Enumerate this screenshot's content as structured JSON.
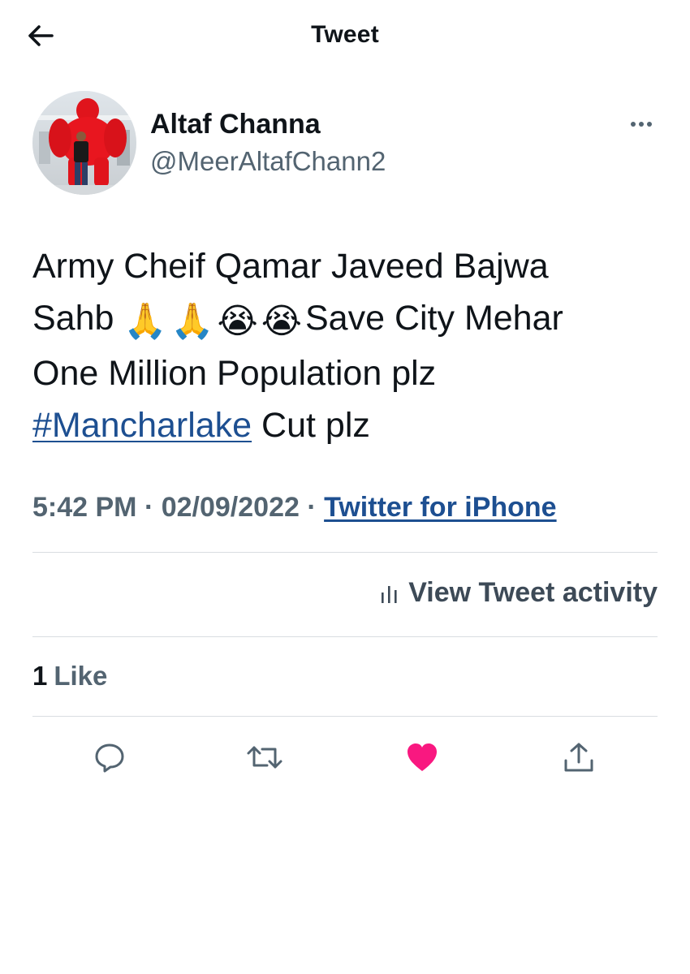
{
  "header": {
    "title": "Tweet",
    "back_icon": "arrow-left-icon"
  },
  "author": {
    "display_name": "Altaf Channa",
    "handle": "@MeerAltafChann2",
    "more_icon": "more-horizontal-icon"
  },
  "tweet": {
    "line1": "Army Cheif  Qamar Javeed Bajwa",
    "line2_prefix": "Sahb",
    "line2_emojis": [
      "🙏",
      "🙏",
      "😭",
      "😭"
    ],
    "line2_suffix": "Save City Mehar",
    "line3": "One Million Population plz",
    "hashtag": "#Mancharlake",
    "line4_suffix": " Cut plz"
  },
  "meta": {
    "time": "5:42 PM",
    "separator": " · ",
    "date": "02/09/2022",
    "source": "Twitter for iPhone"
  },
  "activity": {
    "label": "View Tweet activity",
    "icon": "analytics-bars-icon"
  },
  "likes": {
    "count": "1",
    "label": "Like"
  },
  "actions": {
    "reply_icon": "reply-icon",
    "retweet_icon": "retweet-icon",
    "like_icon": "heart-filled-icon",
    "share_icon": "share-icon"
  },
  "colors": {
    "text": "#0f1419",
    "secondary": "#536471",
    "link": "#1d4f91",
    "like": "#f91880",
    "divider": "#d9dde1"
  }
}
